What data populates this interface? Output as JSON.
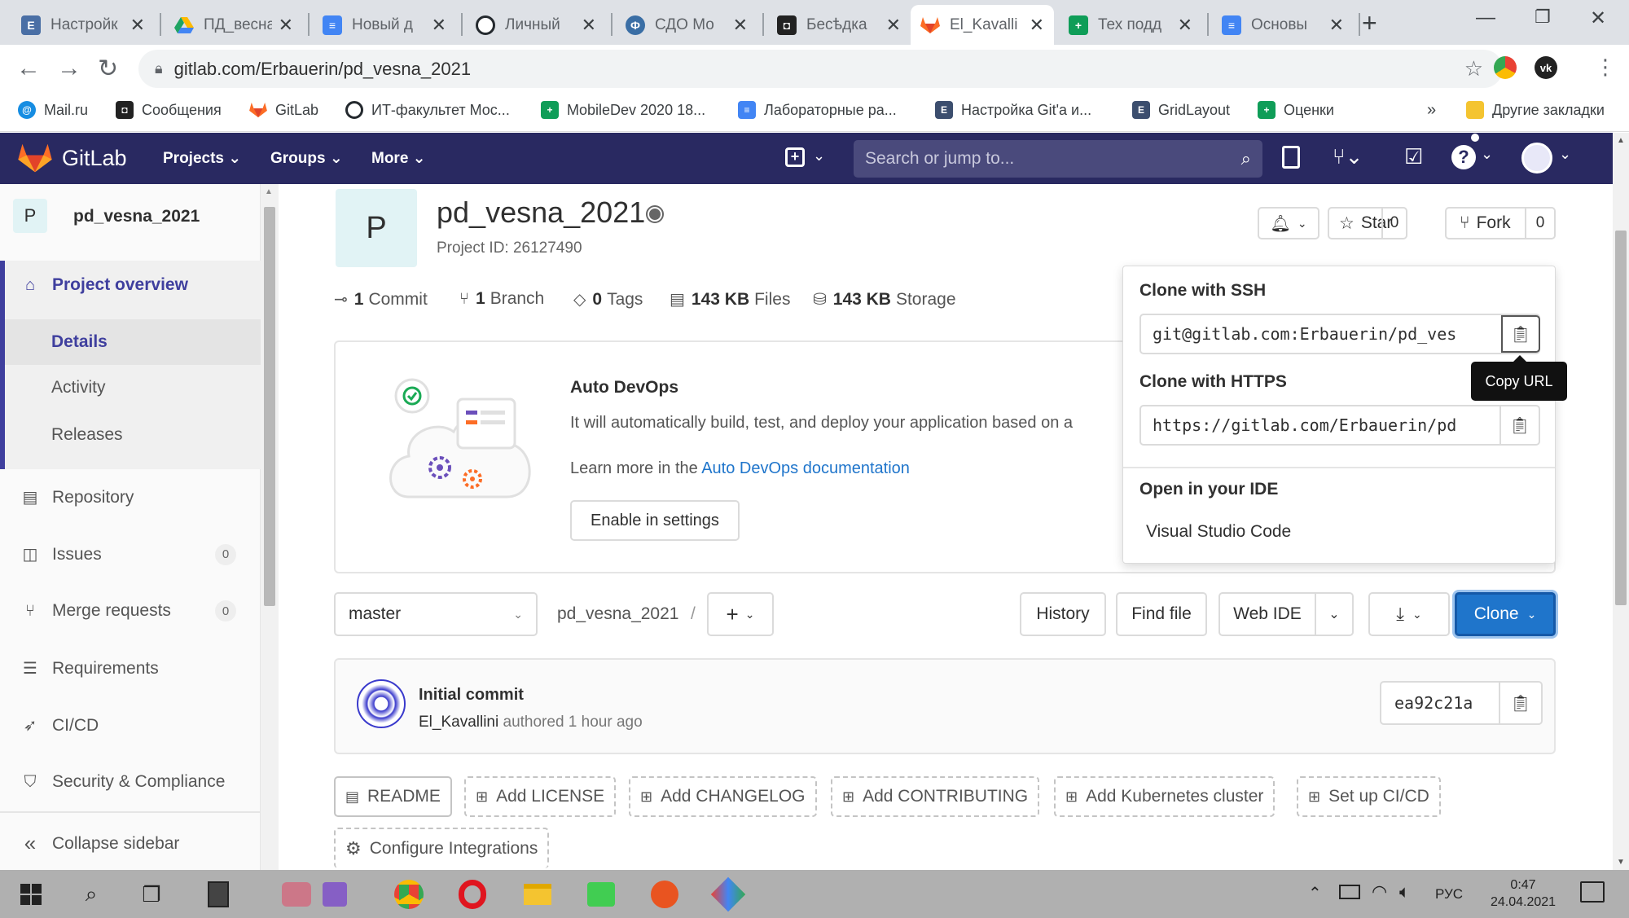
{
  "browser": {
    "tabs": [
      {
        "title": "Настройк",
        "icon": "settings-doc-icon",
        "color": "#4a6fa5"
      },
      {
        "title": "ПД_весна",
        "icon": "google-drive-icon",
        "color": "#1fa463"
      },
      {
        "title": "Новый д",
        "icon": "docs-icon",
        "color": "#4285f4"
      },
      {
        "title": "Личный",
        "icon": "github-icon",
        "color": "#24292e"
      },
      {
        "title": "СДО Мо",
        "icon": "sdo-icon",
        "color": "#3a6ea5"
      },
      {
        "title": "Бесѣдка",
        "icon": "discord-icon",
        "color": "#222"
      },
      {
        "title": "El_Kavalli",
        "icon": "gitlab-icon",
        "color": "#fc6d26"
      },
      {
        "title": "Тех подд",
        "icon": "sheets-icon",
        "color": "#0f9d58"
      },
      {
        "title": "Основы",
        "icon": "docs-icon",
        "color": "#4285f4"
      }
    ],
    "new_tab": "+",
    "url": "gitlab.com/Erbauerin/pd_vesna_2021"
  },
  "bookmarks": [
    {
      "label": "Mail.ru",
      "icon": "mailru-icon",
      "color": "#168de2"
    },
    {
      "label": "Сообщения",
      "icon": "messages-icon",
      "color": "#222"
    },
    {
      "label": "GitLab",
      "icon": "gitlab-icon",
      "color": "#fc6d26"
    },
    {
      "label": "ИТ-факультет Мос...",
      "icon": "github-icon",
      "color": "#24292e"
    },
    {
      "label": "MobileDev 2020 18...",
      "icon": "sheets-icon",
      "color": "#0f9d58"
    },
    {
      "label": "Лабораторные ра...",
      "icon": "docs-icon",
      "color": "#4285f4"
    },
    {
      "label": "Настройка Git'a и...",
      "icon": "e-doc-icon",
      "color": "#3c4e6e"
    },
    {
      "label": "GridLayout",
      "icon": "e-doc-icon",
      "color": "#3c4e6e"
    },
    {
      "label": "Оценки",
      "icon": "sheets-icon",
      "color": "#0f9d58"
    }
  ],
  "bookmarks_more": "»",
  "other_bookmarks": "Другие закладки",
  "gitlab": {
    "brand": "GitLab",
    "nav": [
      "Projects",
      "Groups",
      "More"
    ],
    "search_placeholder": "Search or jump to..."
  },
  "sidebar": {
    "project_letter": "P",
    "project_name": "pd_vesna_2021",
    "items": [
      {
        "label": "Project overview",
        "icon": "home-icon"
      },
      {
        "label": "Details"
      },
      {
        "label": "Activity"
      },
      {
        "label": "Releases"
      },
      {
        "label": "Repository",
        "icon": "repository-icon"
      },
      {
        "label": "Issues",
        "icon": "issues-icon",
        "count": "0"
      },
      {
        "label": "Merge requests",
        "icon": "merge-request-icon",
        "count": "0"
      },
      {
        "label": "Requirements",
        "icon": "requirements-icon"
      },
      {
        "label": "CI/CD",
        "icon": "rocket-icon"
      },
      {
        "label": "Security & Compliance",
        "icon": "shield-icon"
      }
    ],
    "collapse": "Collapse sidebar"
  },
  "project": {
    "avatar_letter": "P",
    "name": "pd_vesna_2021",
    "project_id": "Project ID: 26127490",
    "star_label": "Star",
    "star_count": "0",
    "fork_label": "Fork",
    "fork_count": "0",
    "stats": {
      "commits_num": "1",
      "commits_label": "Commit",
      "branches_num": "1",
      "branches_label": "Branch",
      "tags_num": "0",
      "tags_label": "Tags",
      "files_num": "143 KB",
      "files_label": "Files",
      "storage_num": "143 KB",
      "storage_label": "Storage"
    }
  },
  "autodevops": {
    "title": "Auto DevOps",
    "desc": "It will automatically build, test, and deploy your application based on a",
    "learn_prefix": "Learn more in the",
    "learn_link": "Auto DevOps documentation",
    "enable_button": "Enable in settings"
  },
  "clone": {
    "ssh_label": "Clone with SSH",
    "ssh_url": "git@gitlab.com:Erbauerin/pd_ves",
    "https_label": "Clone with HTTPS",
    "https_url": "https://gitlab.com/Erbauerin/pd",
    "tooltip": "Copy URL",
    "ide_label": "Open in your IDE",
    "ide_option": "Visual Studio Code",
    "button": "Clone"
  },
  "toolbar": {
    "branch": "master",
    "path": "pd_vesna_2021",
    "path_sep": "/",
    "history": "History",
    "find_file": "Find file",
    "web_ide": "Web IDE"
  },
  "commit": {
    "title": "Initial commit",
    "author": "El_Kavallini",
    "meta": "authored 1 hour ago",
    "sha": "ea92c21a"
  },
  "quick_actions": [
    "README",
    "Add LICENSE",
    "Add CHANGELOG",
    "Add CONTRIBUTING",
    "Add Kubernetes cluster",
    "Set up CI/CD",
    "Configure Integrations"
  ],
  "taskbar": {
    "lang": "РУС",
    "time": "0:47",
    "date": "24.04.2021"
  },
  "colors": {
    "gitlab_header": "#292961",
    "accent_blue": "#1f75cb",
    "sidebar_active": "#3f3f9e"
  }
}
